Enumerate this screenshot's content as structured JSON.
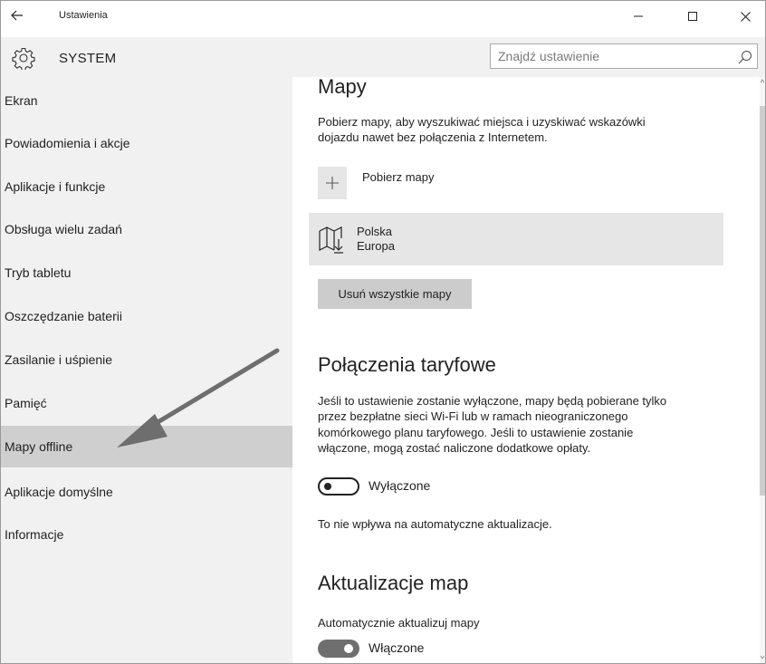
{
  "window": {
    "title": "Ustawienia",
    "minimize_glyph": "–",
    "maximize_glyph": "☐",
    "close_glyph": "✕",
    "back_glyph": "←"
  },
  "header": {
    "section_title": "SYSTEM",
    "search_placeholder": "Znajdź ustawienie",
    "icons": [
      "gear-icon",
      "search-icon"
    ]
  },
  "sidebar": {
    "items": [
      {
        "label": "Ekran"
      },
      {
        "label": "Powiadomienia i akcje"
      },
      {
        "label": "Aplikacje i funkcje"
      },
      {
        "label": "Obsługa wielu zadań"
      },
      {
        "label": "Tryb tabletu"
      },
      {
        "label": "Oszczędzanie baterii"
      },
      {
        "label": "Zasilanie i uśpienie"
      },
      {
        "label": "Pamięć"
      },
      {
        "label": "Mapy offline",
        "selected": true
      },
      {
        "label": "Aplikacje domyślne"
      },
      {
        "label": "Informacje"
      }
    ]
  },
  "main": {
    "maps": {
      "heading": "Mapy",
      "description_line1": "Pobierz mapy, aby wyszukiwać miejsca i uzyskiwać wskazówki",
      "description_line2": "dojazdu nawet bez połączenia z Internetem.",
      "add_label": "Pobierz mapy",
      "downloaded": {
        "name": "Polska",
        "region": "Europa",
        "icon": "map-download-icon"
      },
      "remove_all_label": "Usuń wszystkie mapy"
    },
    "metered": {
      "heading": "Połączenia taryfowe",
      "description_lines": [
        "Jeśli to ustawienie zostanie wyłączone, mapy będą pobierane tylko",
        "przez bezpłatne sieci Wi-Fi lub w ramach nieograniczonego",
        "komórkowego planu taryfowego. Jeśli to ustawienie zostanie",
        "włączone, mogą zostać naliczone dodatkowe opłaty."
      ],
      "toggle_state": "off",
      "toggle_label": "Wyłączone",
      "note": "To nie wpływa na automatyczne aktualizacje."
    },
    "updates": {
      "heading": "Aktualizacje map",
      "auto_label": "Automatycznie aktualizuj mapy",
      "toggle_state": "on",
      "toggle_label": "Włączone"
    }
  },
  "colors": {
    "sidebar_bg": "#f1f1f1",
    "selected_bg": "#cfcfcf",
    "tile_bg": "#e6e6e6",
    "button_bg": "#cccccc",
    "toggle_on": "#6f6f6f",
    "arrow": "#6e6e6e"
  }
}
